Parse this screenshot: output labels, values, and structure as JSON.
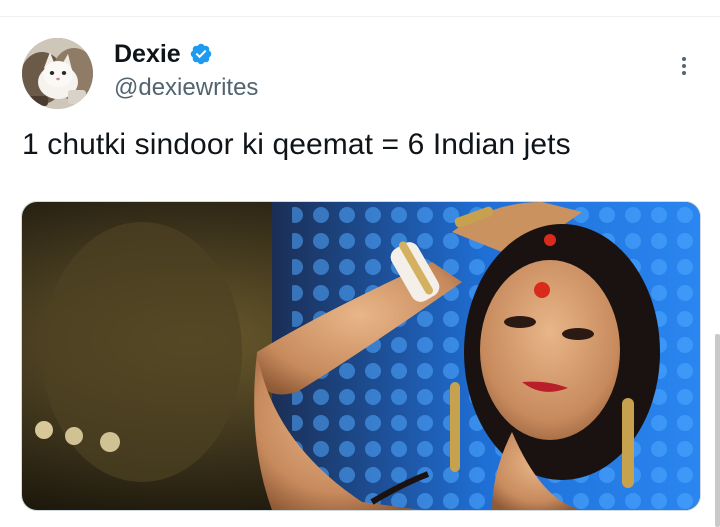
{
  "tweet": {
    "display_name": "Dexie",
    "handle": "@dexiewrites",
    "verified": true,
    "text": "1 chutki sindoor ki qeemat = 6 Indian jets",
    "avatar_icon": "cat-avatar-icon",
    "more_icon": "more-options-icon",
    "verified_color": "#1d9bf0"
  },
  "media": {
    "kind": "photo",
    "subject": "dancer-with-bindi-image"
  }
}
